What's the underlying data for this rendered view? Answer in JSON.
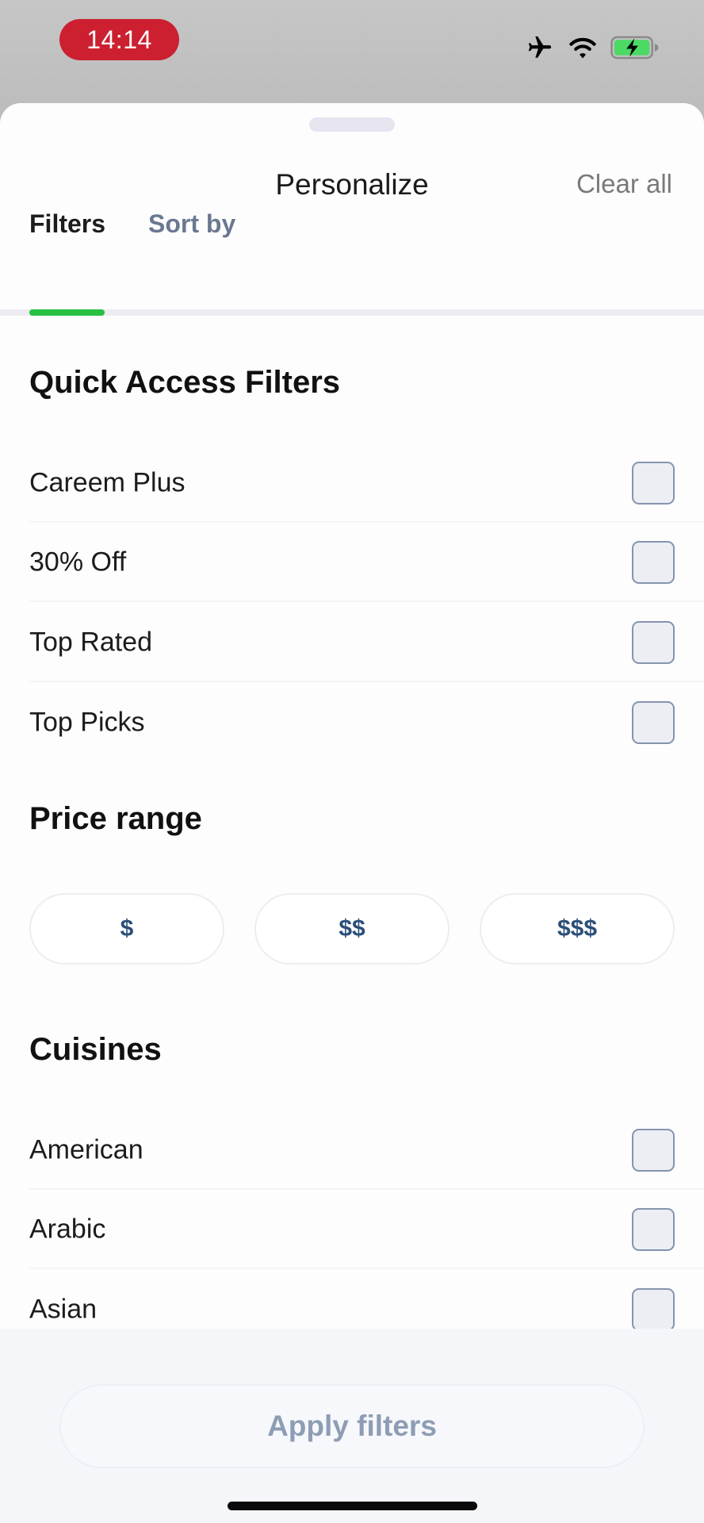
{
  "status_bar": {
    "time": "14:14",
    "icons": [
      "airplane-icon",
      "wifi-icon",
      "battery-charging-icon"
    ],
    "time_pill_color": "#cc2030",
    "battery_color": "#4cd964"
  },
  "sheet": {
    "title": "Personalize",
    "clear_all_label": "Clear all"
  },
  "tabs": [
    {
      "label": "Filters",
      "active": true
    },
    {
      "label": "Sort by",
      "active": false
    }
  ],
  "accent_color": "#28c040",
  "sections": {
    "quick_access": {
      "title": "Quick Access Filters",
      "items": [
        {
          "label": "Careem Plus",
          "checked": false
        },
        {
          "label": "30% Off",
          "checked": false
        },
        {
          "label": "Top Rated",
          "checked": false
        },
        {
          "label": "Top Picks",
          "checked": false
        }
      ]
    },
    "price_range": {
      "title": "Price range",
      "options": [
        {
          "label": "$",
          "selected": false
        },
        {
          "label": "$$",
          "selected": false
        },
        {
          "label": "$$$",
          "selected": false
        }
      ]
    },
    "cuisines": {
      "title": "Cuisines",
      "items": [
        {
          "label": "American",
          "checked": false
        },
        {
          "label": "Arabic",
          "checked": false
        },
        {
          "label": "Asian",
          "checked": false
        }
      ]
    }
  },
  "footer": {
    "apply_label": "Apply filters",
    "apply_enabled": false
  }
}
